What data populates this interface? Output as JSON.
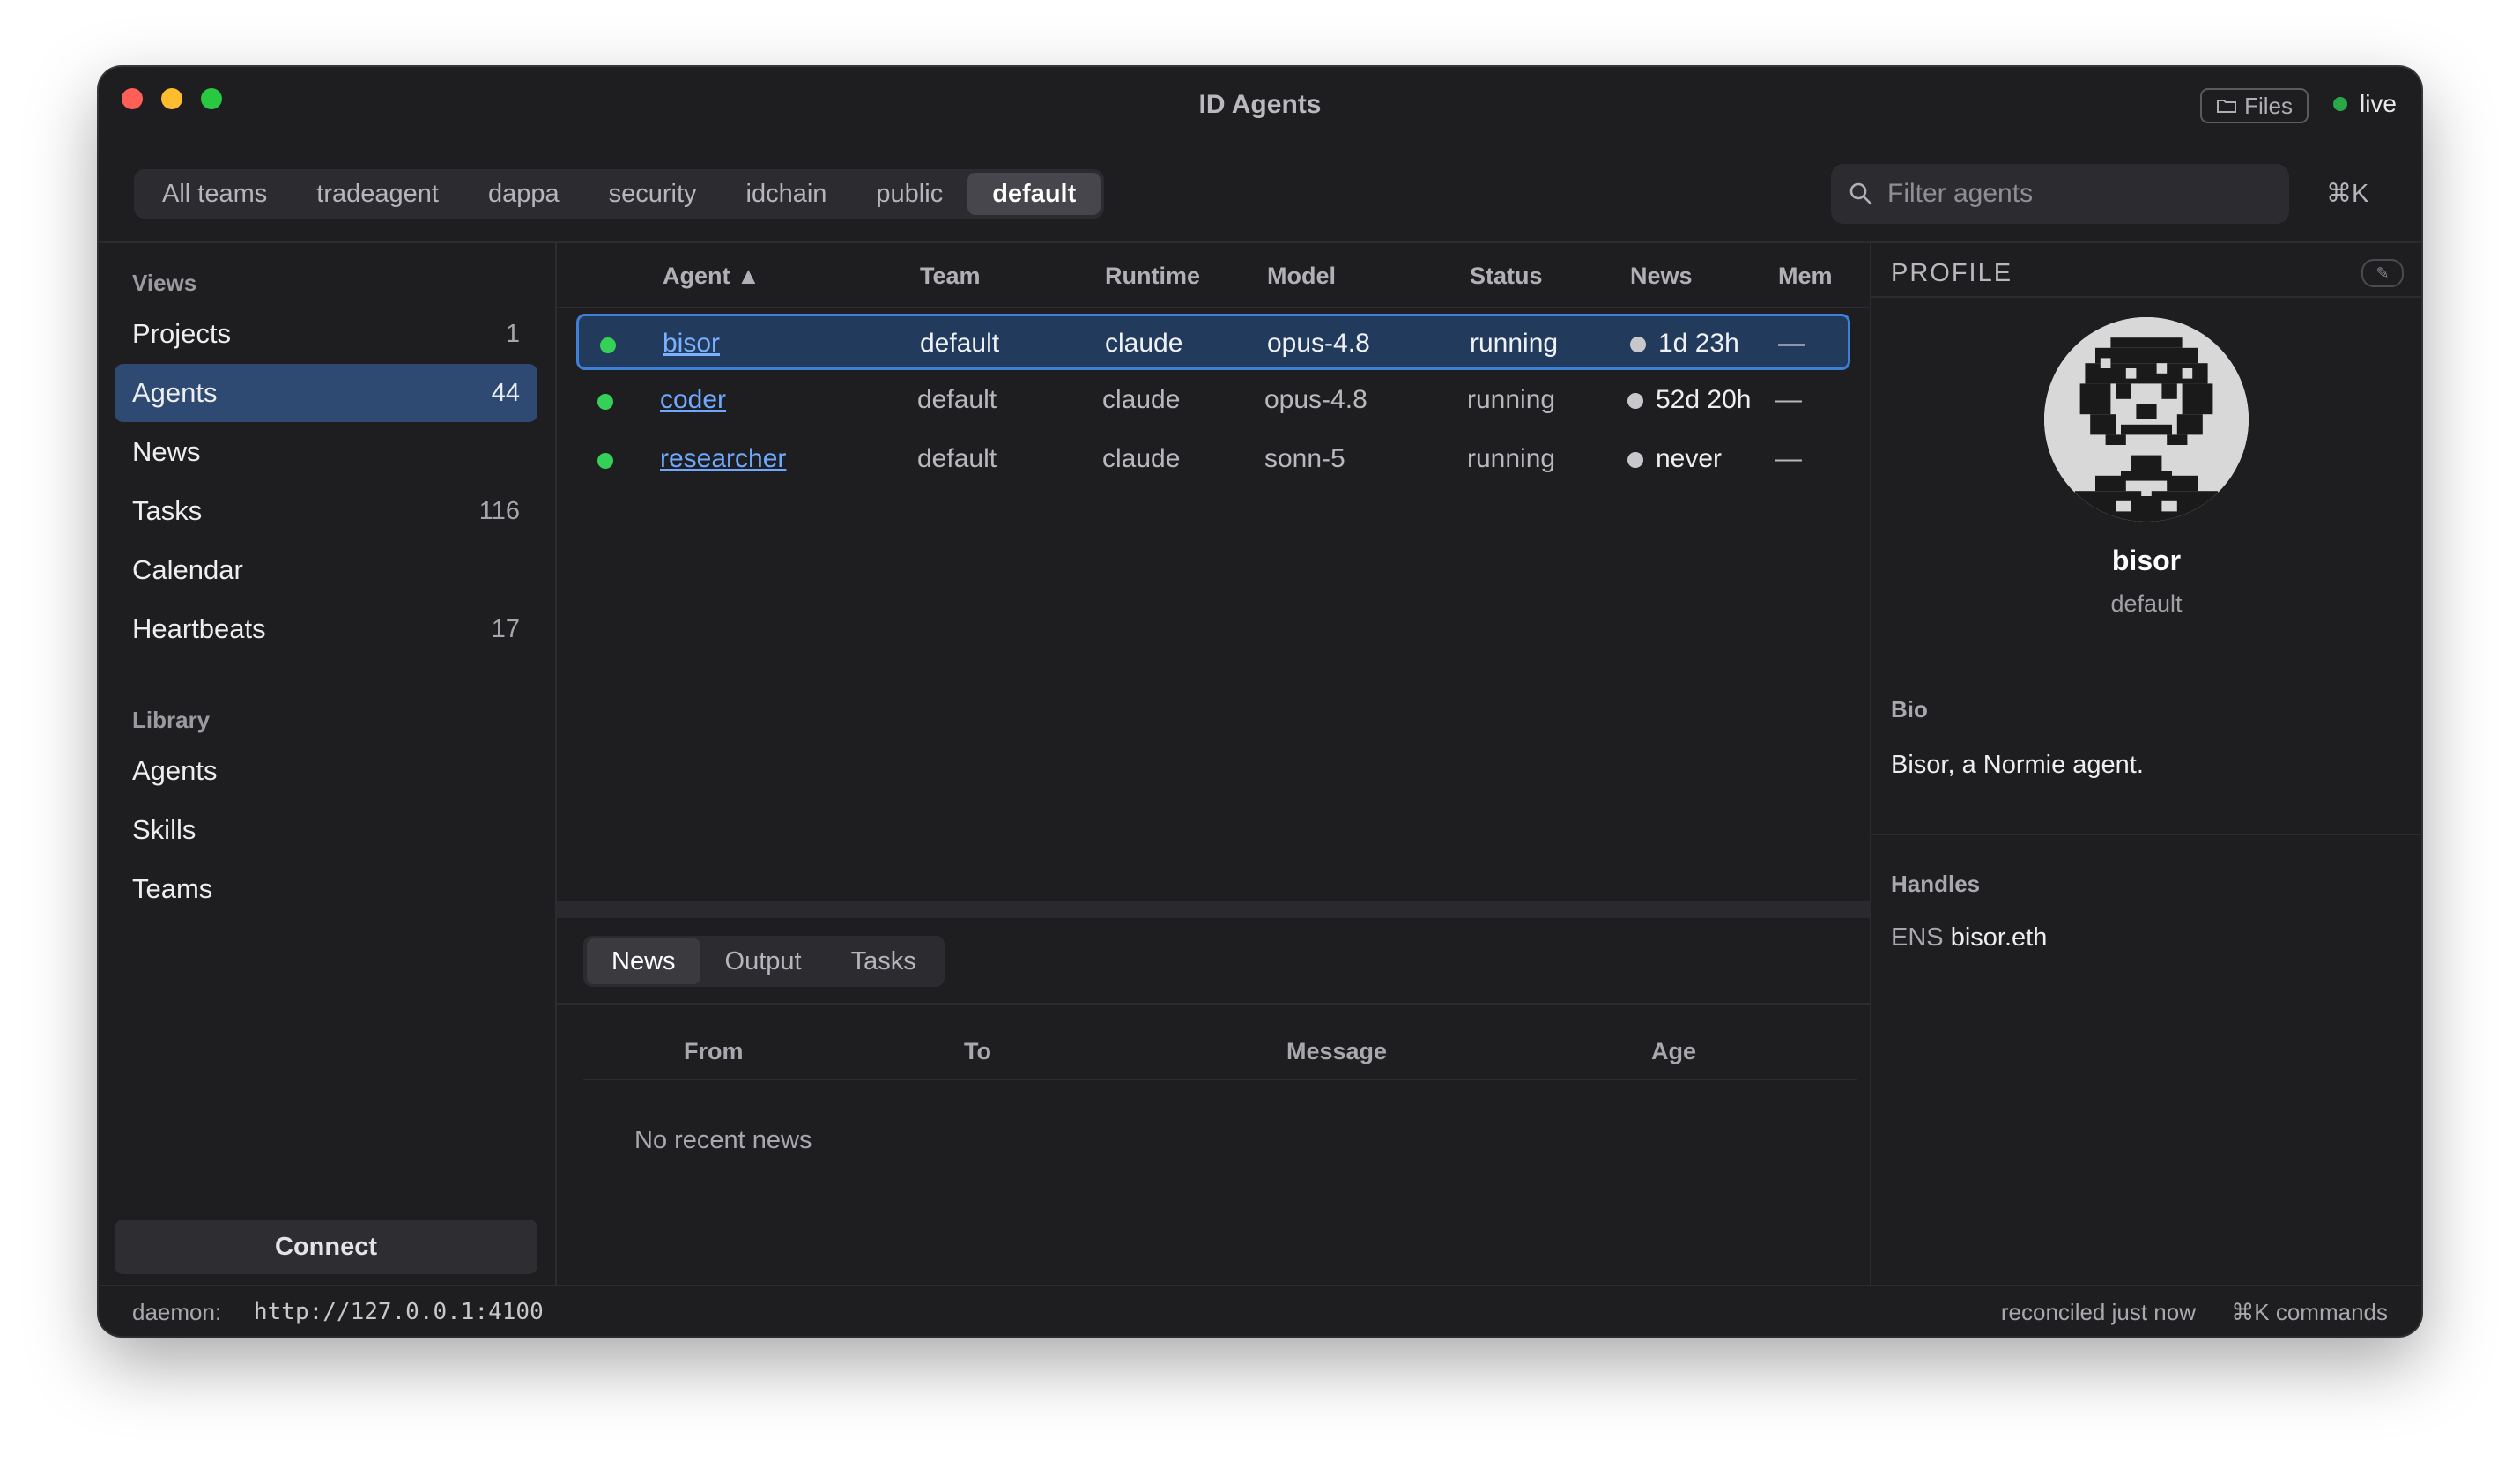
{
  "window": {
    "title": "ID Agents",
    "files_label": "Files",
    "live_label": "live",
    "traffic_lights": {
      "close": "#ff5f57",
      "minimize": "#febc2e",
      "zoom": "#28c840"
    }
  },
  "team_tabs": [
    "All teams",
    "tradeagent",
    "dappa",
    "security",
    "idchain",
    "public",
    "default"
  ],
  "active_team": "default",
  "search": {
    "placeholder": "Filter agents",
    "shortcut": "⌘K"
  },
  "sidebar": {
    "views_title": "Views",
    "views": [
      {
        "label": "Projects",
        "count": "1"
      },
      {
        "label": "Agents",
        "count": "44",
        "active": true
      },
      {
        "label": "News",
        "count": ""
      },
      {
        "label": "Tasks",
        "count": "116"
      },
      {
        "label": "Calendar",
        "count": ""
      },
      {
        "label": "Heartbeats",
        "count": "17"
      }
    ],
    "library_title": "Library",
    "library": [
      {
        "label": "Agents"
      },
      {
        "label": "Skills"
      },
      {
        "label": "Teams"
      }
    ],
    "connect_label": "Connect"
  },
  "agents_table": {
    "columns": [
      "Agent ▲",
      "Team",
      "Runtime",
      "Model",
      "Status",
      "News",
      "Mem"
    ],
    "rows": [
      {
        "agent": "bisor",
        "team": "default",
        "runtime": "claude",
        "model": "opus-4.8",
        "status": "running",
        "news": "1d 23h",
        "mem": "—",
        "selected": true
      },
      {
        "agent": "coder",
        "team": "default",
        "runtime": "claude",
        "model": "opus-4.8",
        "status": "running",
        "news": "52d 20h",
        "mem": "—"
      },
      {
        "agent": "researcher",
        "team": "default",
        "runtime": "claude",
        "model": "sonn-5",
        "status": "running",
        "news": "never",
        "mem": "—"
      }
    ],
    "status_color": "#34d058"
  },
  "bottom_panel": {
    "tabs": [
      "News",
      "Output",
      "Tasks"
    ],
    "active_tab": "News",
    "columns": [
      "From",
      "To",
      "Message",
      "Age"
    ],
    "empty_text": "No recent news"
  },
  "profile": {
    "title": "PROFILE",
    "edit_icon": "pencil-icon",
    "name": "bisor",
    "team": "default",
    "bio_label": "Bio",
    "bio": "Bisor, a Normie agent.",
    "handles_label": "Handles",
    "handles": [
      {
        "type": "ENS",
        "value": "bisor.eth"
      }
    ]
  },
  "statusbar": {
    "daemon_label": "daemon:",
    "daemon_url": "http://127.0.0.1:4100",
    "reconciled": "reconciled just now",
    "commands": "⌘K commands"
  },
  "colors": {
    "accent": "#3f7fd8",
    "selection": "#223a5c",
    "sidebar_active": "#2e4a72",
    "link": "#6ea8ff"
  }
}
